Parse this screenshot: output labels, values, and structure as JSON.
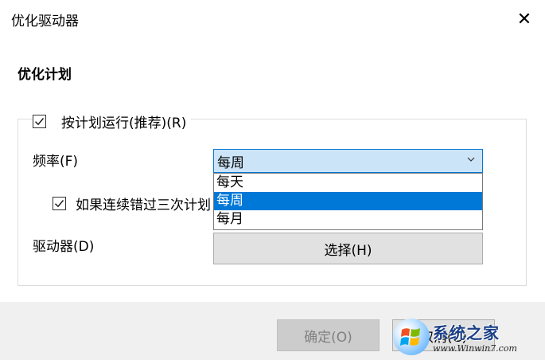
{
  "window": {
    "title": "优化驱动器",
    "close_glyph": "✕"
  },
  "section_title": "优化计划",
  "schedule_checkbox": {
    "label": "按计划运行(推荐)(R)",
    "checked": true
  },
  "frequency": {
    "label": "频率(F)",
    "selected": "每周",
    "options": [
      "每天",
      "每周",
      "每月"
    ],
    "highlighted_index": 1
  },
  "missed_checkbox": {
    "label": "如果连续错过三次计划",
    "checked": true
  },
  "drives": {
    "label": "驱动器(D)",
    "choose_button": "选择(H)"
  },
  "buttons": {
    "ok": "确定(O)",
    "cancel": "取消(C)"
  },
  "watermark": {
    "name": "系统之家",
    "url": "www.Winwin7.com"
  },
  "colors": {
    "accent": "#0078d7",
    "select_bg": "#cce4f7",
    "footer_bg": "#f0f0f0"
  },
  "icons": {
    "check": "check-icon",
    "chevron": "chevron-down-icon",
    "close": "close-icon"
  }
}
